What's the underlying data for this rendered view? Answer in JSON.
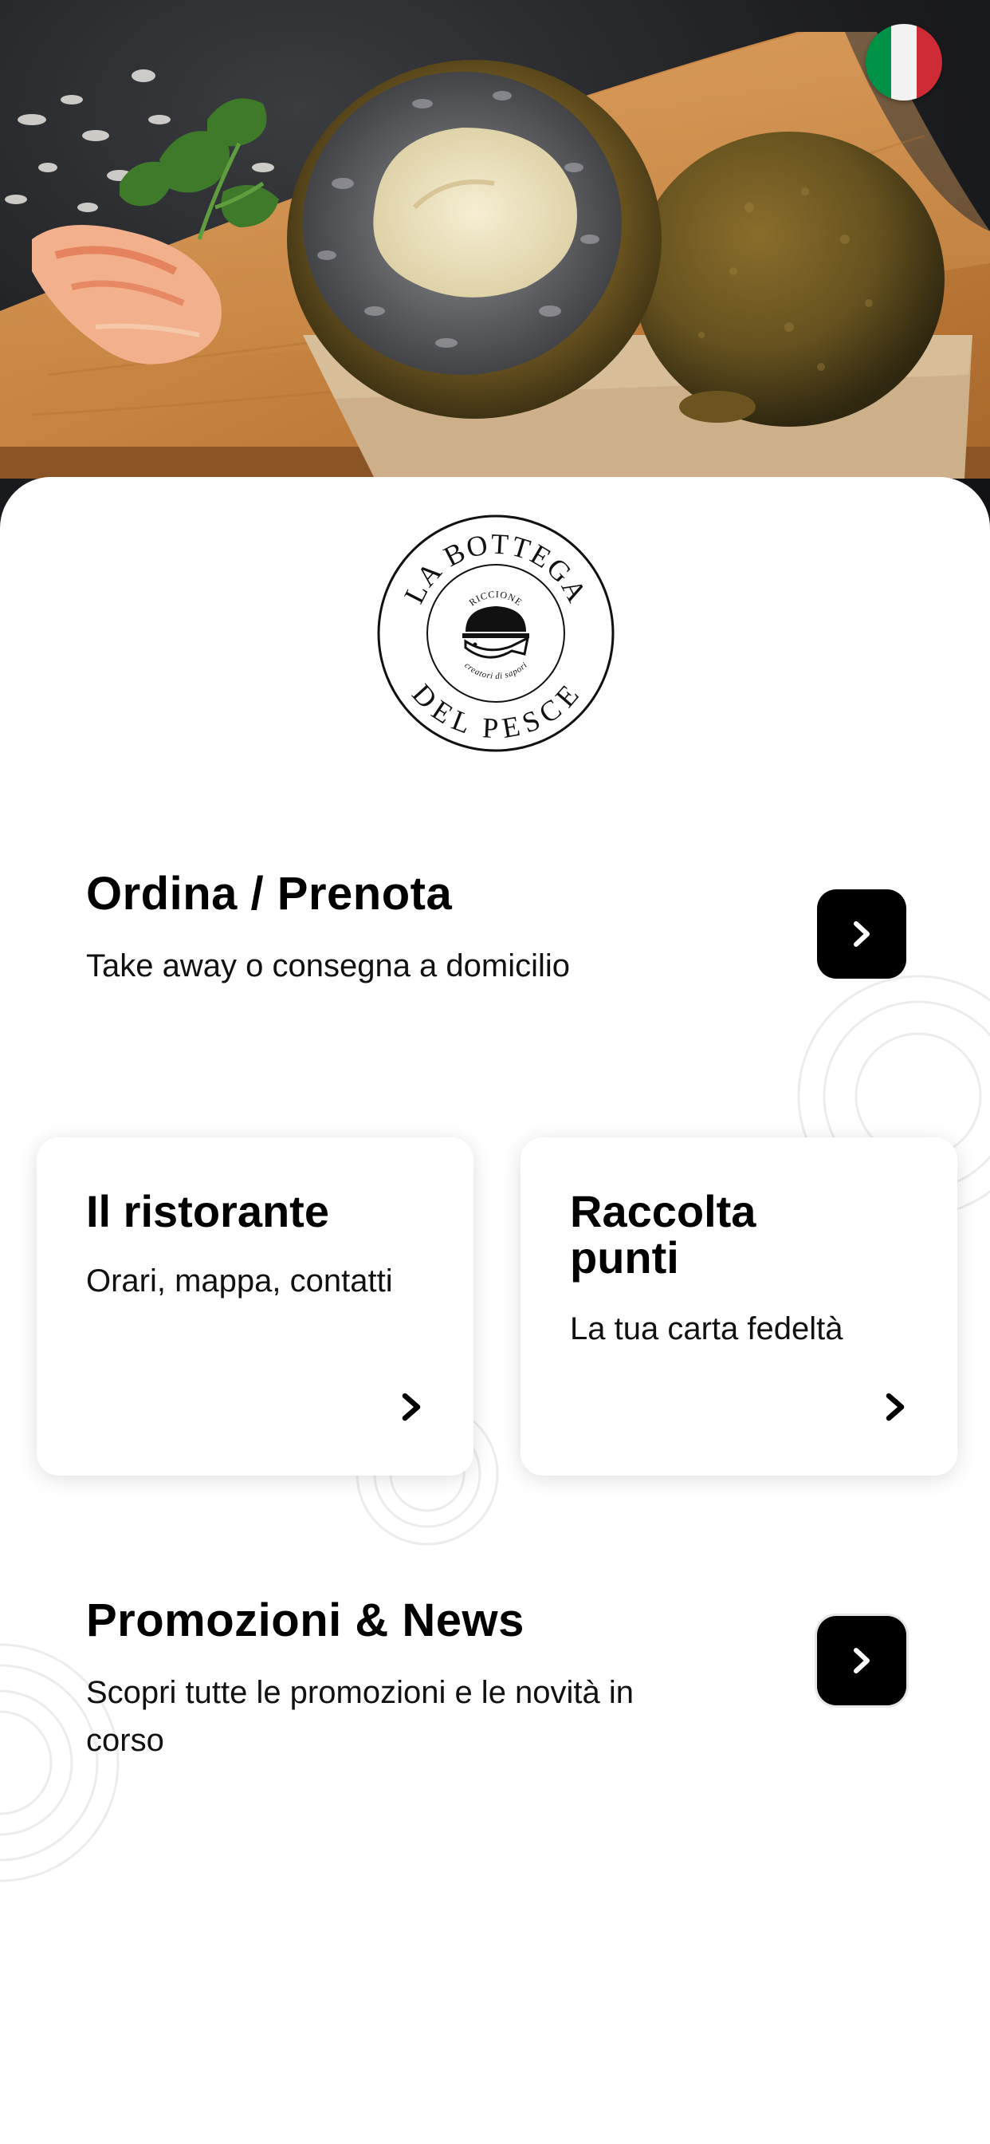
{
  "language": {
    "icon": "italian-flag-icon",
    "colors": [
      "#009246",
      "#f1f2f1",
      "#ce2b37"
    ]
  },
  "logo": {
    "top_text": "LA BOTTEGA",
    "bottom_text": "DEL PESCE",
    "city": "RICCIONE",
    "tagline": "creatori di sapori",
    "icon": "fish-burger-icon"
  },
  "menu": {
    "order": {
      "title": "Ordina / Prenota",
      "subtitle": "Take away o consegna a domicilio",
      "icon": "chevron-right-icon"
    },
    "restaurant": {
      "title": "Il ristorante",
      "subtitle": "Orari, mappa, contatti",
      "icon": "chevron-right-icon"
    },
    "loyalty": {
      "title": "Raccolta punti",
      "subtitle": "La tua carta fedeltà",
      "icon": "chevron-right-icon"
    },
    "news": {
      "title": "Promozioni & News",
      "subtitle": "Scopri tutte le promozioni e le novità in corso",
      "icon": "chevron-right-icon"
    }
  },
  "colors": {
    "accent": "#000000",
    "background": "#ffffff",
    "ring": "#ececec"
  }
}
